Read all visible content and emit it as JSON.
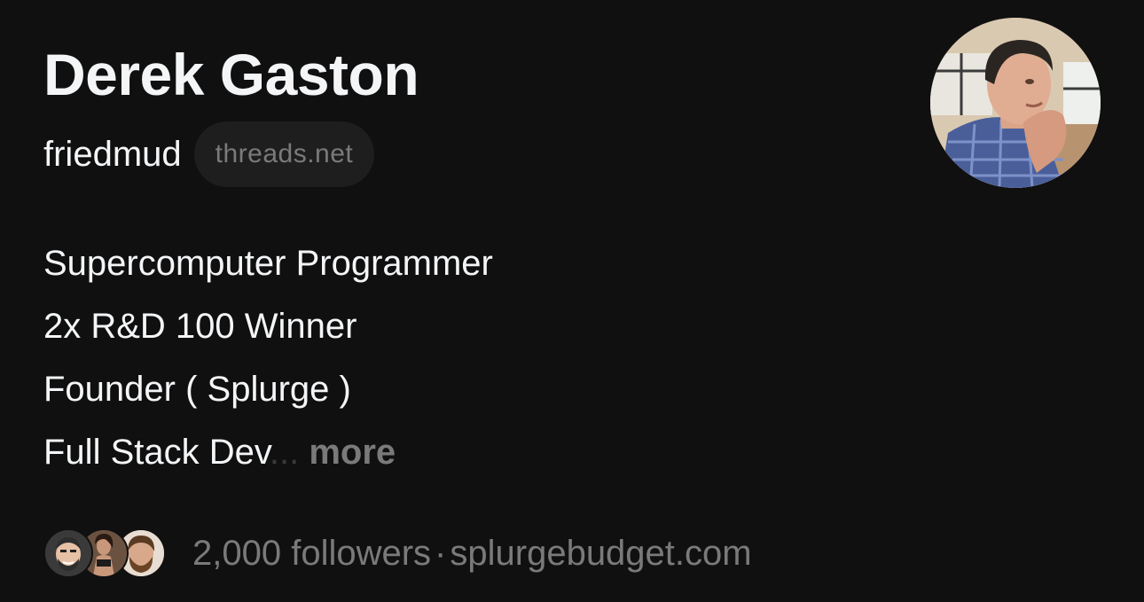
{
  "profile": {
    "display_name": "Derek Gaston",
    "handle": "friedmud",
    "domain_badge": "threads.net",
    "avatar_icon": "profile-photo"
  },
  "bio": {
    "lines": [
      "Supercomputer Programmer",
      "2x R&D 100 Winner",
      "Founder ( Splurge )",
      "Full Stack Dev"
    ],
    "ellipsis": "...",
    "more_label": "more"
  },
  "footer": {
    "followers_text": "2,000 followers",
    "separator": "·",
    "website": "splurgebudget.com"
  },
  "colors": {
    "background": "#101010",
    "primary_text": "#f3f5f7",
    "secondary_text": "#7a7a7a",
    "badge_bg": "#1e1e1e"
  }
}
